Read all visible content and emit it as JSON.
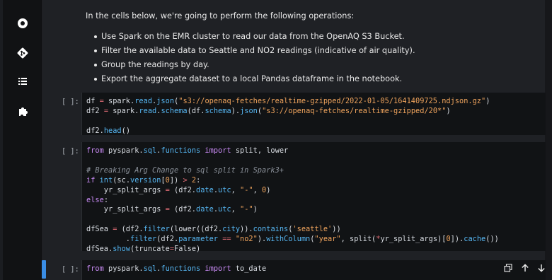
{
  "markdown": {
    "intro": "In the cells below, we're going to perform the following operations:",
    "items": [
      "Use Spark on the EMR cluster to read our data from the OpenAQ S3 Bucket.",
      "Filter the available data to Seattle and NO2 readings (indicative of air quality).",
      "Group the readings by day.",
      "Export the aggregate dataset to a local Pandas dataframe in the notebook."
    ]
  },
  "cells": [
    {
      "prompt": "[ ]:",
      "lines": [
        "df = spark.read.json(\"s3://openaq-fetches/realtime-gzipped/2022-01-05/1641409725.ndjson.gz\")",
        "df2 = spark.read.schema(df.schema).json(\"s3://openaq-fetches/realtime-gzipped/20*\")",
        "",
        "df2.head()"
      ]
    },
    {
      "prompt": "[ ]:",
      "lines": [
        "from pyspark.sql.functions import split, lower",
        "",
        "# Breaking Arg Change to sql split in Spark3+",
        "if int(sc.version[0]) > 2:",
        "    yr_split_args = (df2.date.utc, \"-\", 0)",
        "else:",
        "    yr_split_args = (df2.date.utc, \"-\")",
        "",
        "dfSea = (df2.filter(lower((df2.city)).contains('seattle'))",
        "         .filter(df2.parameter == \"no2\").withColumn(\"year\", split(*yr_split_args)[0]).cache())",
        "dfSea.show(truncate=False)"
      ]
    },
    {
      "prompt": "[ ]:",
      "lines": [
        "from pyspark.sql.functions import to_date"
      ]
    }
  ],
  "sidebar": {
    "icons": [
      "circle-stop-icon",
      "git-icon",
      "list-icon",
      "puzzle-icon"
    ]
  },
  "cell_toolbar": {
    "icons": [
      "copy-icon",
      "arrow-up-icon",
      "arrow-down-icon"
    ]
  },
  "colors": {
    "background": "#1f2125",
    "code_background": "#111315",
    "active_cell_bar": "#3a8ee6",
    "keyword": "#56b6f2",
    "string": "#f0a45d"
  }
}
